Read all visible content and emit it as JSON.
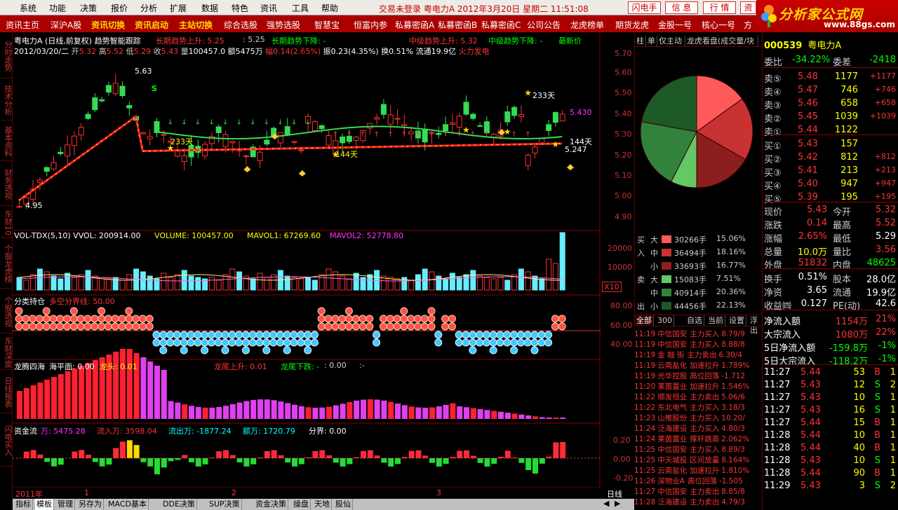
{
  "menu": [
    "系统",
    "功能",
    "决策",
    "报价",
    "分析",
    "扩展",
    "数据",
    "特色",
    "资讯",
    "工具",
    "帮助"
  ],
  "status_text": "交易未登录  粤电力A  2012年3月20日 星期二  11:51:08",
  "top_buttons": [
    "闪电手",
    "信 息",
    "行 情",
    "资"
  ],
  "brand": {
    "title": "分析家公式网",
    "url": "www.88gs.com"
  },
  "toolbar": [
    {
      "label": "资讯主页",
      "hl": false
    },
    {
      "label": "深沪A股",
      "hl": false
    },
    {
      "label": "资讯切换",
      "hl": true
    },
    {
      "label": "资讯启动",
      "hl": true
    },
    {
      "label": "主站切换",
      "hl": true
    },
    {
      "label": "综合选股",
      "hl": false
    },
    {
      "label": "强势选股",
      "hl": false
    },
    {
      "label": "智慧宝",
      "hl": false
    },
    {
      "label": "恒富内参",
      "hl": false
    },
    {
      "label": "私募密函A",
      "hl": false
    },
    {
      "label": "私募密函B",
      "hl": false
    },
    {
      "label": "私募密函C",
      "hl": false
    },
    {
      "label": "公司公告",
      "hl": false
    },
    {
      "label": "龙虎榜单",
      "hl": false
    },
    {
      "label": "期货龙虎",
      "hl": false
    },
    {
      "label": "金股一号",
      "hl": false
    },
    {
      "label": "核心一号",
      "hl": false
    },
    {
      "label": "方",
      "hl": false
    }
  ],
  "left_tabs": [
    "分时走势",
    "技术分析",
    "基本资料",
    "财务透视",
    "东财10",
    "个股龙虎榜",
    "个股透视",
    "东财深度",
    "日线报表",
    "闪电买入"
  ],
  "chart": {
    "main_title": "粤电力A (日线,前复权) 趋势智能跟踪",
    "line1_long_up": "长期趋势上升: 5.25",
    "line1_val2": ": 5.25",
    "line1_long_down": "长期趋势下降: -",
    "line1_mid_up": "中级趋势上升: 5.32",
    "line1_mid_down": "中级趋势下降: -",
    "line1_latest": "最新价",
    "info_line": {
      "date": "2012/03/20/二",
      "open_label": "开",
      "open": "5.32",
      "high_label": "高",
      "high": "5.52",
      "low_label": "低",
      "low": "5.29",
      "close_label": "收",
      "close": "5.43",
      "vol_label": "量",
      "vol": "100457.0",
      "amt": "额5475万",
      "chg": "幅0.14(2.65%)",
      "amp": "振0.23(4.35%)",
      "turn": "换0.51%",
      "float": "流通19.9亿",
      "hot": "火力发电"
    },
    "price_axis": [
      "5.70",
      "5.60",
      "5.50",
      "5.40",
      "5.30",
      "5.20",
      "5.10",
      "5.00",
      "4.90"
    ],
    "annotations": {
      "high": "5.63",
      "low": "4.95",
      "star1": "233天",
      "star2": "144天",
      "star3": "233天",
      "star4": "144天",
      "star5": "144天",
      "star6": "233天",
      "star7": "144天",
      "last": "5.247",
      "right_val": "5.430",
      "s_mark": "S",
      "b_mark": "B"
    },
    "vol_title": "VOL-TDX(5,10)  VVOL: 200914.00",
    "vol_volume": "VOLUME: 100457.00",
    "vol_ma1": "MAVOL1: 67269.60",
    "vol_ma2": "MAVOL2: 52778.80",
    "vol_axis": [
      "20000",
      "10000"
    ],
    "vol_unit": "X10",
    "pos_title": "分类持仓",
    "pos_line": "多空分界线: 50.00",
    "pos_axis": [
      "80.00",
      "60.00",
      "40.00"
    ],
    "dragon_title": "龙腾四海",
    "dragon_sea": "海平面: 0.00",
    "dragon_head": "龙头: 0.01",
    "dragon_tail_up": "龙尾上升: 0.01",
    "dragon_tail_down": "龙尾下跌: -",
    "dragon_tail_down2": ": 0.00",
    "dragon_colon": ":-",
    "fund_title": "资金流",
    "fund_wan": "万: 5475.28",
    "fund_in": "流入万: 3598.04",
    "fund_out": "流出万: -1877.24",
    "fund_amt": "额万: 1720.79",
    "fund_border": "分界: 0.00",
    "fund_axis": [
      "0.20",
      "0.00",
      "-0.20"
    ],
    "time_axis": [
      "2011年",
      "1",
      "2",
      "3"
    ],
    "period": "日线"
  },
  "bottom_tabs": [
    "指标",
    "模板",
    "管理",
    "另存为",
    "MACD基本",
    "DDE决策",
    "SUP决策",
    "资金决策",
    "操盘",
    "天地",
    "股仙"
  ],
  "pie_panel": {
    "tabs": [
      "柱",
      "单",
      "仅主动",
      "龙虎看盘(成交量/块"
    ],
    "slices": [
      15.06,
      18.16,
      16.77,
      7.51,
      20.36,
      22.13
    ],
    "buy_label": "买入",
    "sell_label": "卖出",
    "rows": [
      {
        "side": "买",
        "size": "大",
        "vol": "30266手",
        "pct": "15.06%",
        "color": "#ff5a5a"
      },
      {
        "side": "入",
        "size": "中",
        "vol": "36494手",
        "pct": "18.16%",
        "color": "#c83232"
      },
      {
        "side": "",
        "size": "小",
        "vol": "33693手",
        "pct": "16.77%",
        "color": "#8c1e1e"
      },
      {
        "side": "卖",
        "size": "大",
        "vol": "15083手",
        "pct": "7.51%",
        "color": "#64c864"
      },
      {
        "side": "",
        "size": "中",
        "vol": "40914手",
        "pct": "20.36%",
        "color": "#32823c"
      },
      {
        "side": "出",
        "size": "小",
        "vol": "44456手",
        "pct": "22.13%",
        "color": "#1e5a28"
      }
    ],
    "sub_tabs": [
      "全部",
      "300",
      "自选",
      "当前",
      "设置",
      "浮出"
    ]
  },
  "news": [
    {
      "t": "11:19",
      "n": "中信国安",
      "a": "主力买入",
      "v": "8.79/9"
    },
    {
      "t": "11:19",
      "n": "中信国安",
      "a": "主力买入",
      "v": "8.88/8"
    },
    {
      "t": "11:19",
      "n": "金 融 街",
      "a": "主力卖出",
      "v": "6.30/4"
    },
    {
      "t": "11:19",
      "n": "云南盐化",
      "a": "加速拉升",
      "v": "1.789%"
    },
    {
      "t": "11:19",
      "n": "光华控股",
      "a": "高位回落",
      "v": "-1.712"
    },
    {
      "t": "11:20",
      "n": "莱茵置业",
      "a": "加速拉升",
      "v": "1.546%"
    },
    {
      "t": "11:22",
      "n": "顺发恒业",
      "a": "主力卖出",
      "v": "5.06/6"
    },
    {
      "t": "11:22",
      "n": "东北电气",
      "a": "主力买入",
      "v": "3.18/3"
    },
    {
      "t": "11:23",
      "n": "山推股份",
      "a": "主力买入",
      "v": "10.20/"
    },
    {
      "t": "11:24",
      "n": "泛海建设",
      "a": "主力买入",
      "v": "4.80/3"
    },
    {
      "t": "11:24",
      "n": "莱茵置业",
      "a": "撑杆跳高",
      "v": "2.062%"
    },
    {
      "t": "11:25",
      "n": "中信国安",
      "a": "主力买入",
      "v": "8.89/3"
    },
    {
      "t": "11:25",
      "n": "中天城投",
      "a": "区间放量",
      "v": "8.164%"
    },
    {
      "t": "11:25",
      "n": "云南盐化",
      "a": "加速拉升",
      "v": "1.810%"
    },
    {
      "t": "11:26",
      "n": "深物业A",
      "a": "高位回落",
      "v": "-1.505"
    },
    {
      "t": "11:27",
      "n": "中信国安",
      "a": "主力卖出",
      "v": "8.85/8"
    },
    {
      "t": "11:28",
      "n": "泛海建设",
      "a": "主力卖出",
      "v": "4.79/3"
    }
  ],
  "quote": {
    "code": "000539",
    "name": "粤电力A",
    "weibi_label": "委比",
    "weibi": "-34.22%",
    "weicha_label": "委差",
    "weicha": "-2418",
    "asks": [
      {
        "l": "卖⑤",
        "p": "5.48",
        "v": "1177",
        "c": "+1177"
      },
      {
        "l": "卖④",
        "p": "5.47",
        "v": "746",
        "c": "+746"
      },
      {
        "l": "卖③",
        "p": "5.46",
        "v": "658",
        "c": "+658"
      },
      {
        "l": "卖②",
        "p": "5.45",
        "v": "1039",
        "c": "+1039"
      },
      {
        "l": "卖①",
        "p": "5.44",
        "v": "1122",
        "c": ""
      }
    ],
    "bids": [
      {
        "l": "买①",
        "p": "5.43",
        "v": "157",
        "c": ""
      },
      {
        "l": "买②",
        "p": "5.42",
        "v": "812",
        "c": "+812"
      },
      {
        "l": "买③",
        "p": "5.41",
        "v": "213",
        "c": "+213"
      },
      {
        "l": "买④",
        "p": "5.40",
        "v": "947",
        "c": "+947"
      },
      {
        "l": "买⑤",
        "p": "5.39",
        "v": "195",
        "c": "+195"
      }
    ],
    "stats": [
      {
        "a": "现价",
        "av": "5.43",
        "b": "今开",
        "bv": "5.32"
      },
      {
        "a": "涨跌",
        "av": "0.14",
        "b": "最高",
        "bv": "5.52"
      },
      {
        "a": "涨幅",
        "av": "2.65%",
        "b": "最低",
        "bv": "5.29"
      },
      {
        "a": "总量",
        "av": "10.0万",
        "b": "量比",
        "bv": "3.56"
      },
      {
        "a": "外盘",
        "av": "51832",
        "b": "内盘",
        "bv": "48625"
      }
    ],
    "stats2": [
      {
        "a": "换手",
        "av": "0.51%",
        "b": "股本",
        "bv": "28.0亿"
      },
      {
        "a": "净资",
        "av": "3.65",
        "b": "流通",
        "bv": "19.9亿"
      },
      {
        "a": "收益㈣",
        "av": "0.127",
        "b": "PE(动)",
        "bv": "42.6"
      }
    ],
    "flows": [
      {
        "l": "净流入额",
        "v": "1154万",
        "p": "21%"
      },
      {
        "l": "大宗流入",
        "v": "1080万",
        "p": "22%"
      },
      {
        "l": "5日净流入额",
        "v": "-159.8万",
        "p": "-1%"
      },
      {
        "l": "5日大宗流入",
        "v": "-118.2万",
        "p": "-1%"
      }
    ],
    "ticks": [
      {
        "t": "11:27",
        "p": "5.44",
        "v": "53",
        "d": "B",
        "n": "1"
      },
      {
        "t": "11:27",
        "p": "5.43",
        "v": "12",
        "d": "S",
        "n": "2"
      },
      {
        "t": "11:27",
        "p": "5.43",
        "v": "10",
        "d": "S",
        "n": "1"
      },
      {
        "t": "11:27",
        "p": "5.43",
        "v": "16",
        "d": "S",
        "n": "1"
      },
      {
        "t": "11:27",
        "p": "5.44",
        "v": "15",
        "d": "B",
        "n": "1"
      },
      {
        "t": "11:28",
        "p": "5.44",
        "v": "10",
        "d": "B",
        "n": "1"
      },
      {
        "t": "11:28",
        "p": "5.44",
        "v": "40",
        "d": "B",
        "n": "1"
      },
      {
        "t": "11:28",
        "p": "5.43",
        "v": "10",
        "d": "S",
        "n": "1"
      },
      {
        "t": "11:28",
        "p": "5.44",
        "v": "90",
        "d": "B",
        "n": "1"
      },
      {
        "t": "11:29",
        "p": "5.43",
        "v": "3",
        "d": "S",
        "n": "2"
      }
    ]
  }
}
